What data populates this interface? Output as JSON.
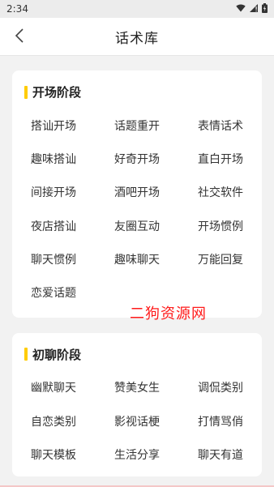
{
  "status_bar": {
    "time": "2:34",
    "icons": [
      "wifi-icon",
      "signal-icon",
      "battery-icon"
    ]
  },
  "header": {
    "title": "话术库",
    "back_icon": "chevron-left-icon"
  },
  "sections": [
    {
      "title": "开场阶段",
      "items": [
        "搭讪开场",
        "话题重开",
        "表情话术",
        "趣味搭讪",
        "好奇开场",
        "直白开场",
        "间接开场",
        "酒吧开场",
        "社交软件",
        "夜店搭讪",
        "友圈互动",
        "开场惯例",
        "聊天惯例",
        "趣味聊天",
        "万能回复",
        "恋爱话题"
      ]
    },
    {
      "title": "初聊阶段",
      "items": [
        "幽默聊天",
        "赞美女生",
        "调侃类别",
        "自恋类别",
        "影视话梗",
        "打情骂俏",
        "聊天模板",
        "生活分享",
        "聊天有道"
      ]
    }
  ],
  "watermark": "二狗资源网",
  "colors": {
    "accent": "#ffcc00",
    "watermark": "#ff1a1a",
    "background": "#f2f2f2"
  }
}
